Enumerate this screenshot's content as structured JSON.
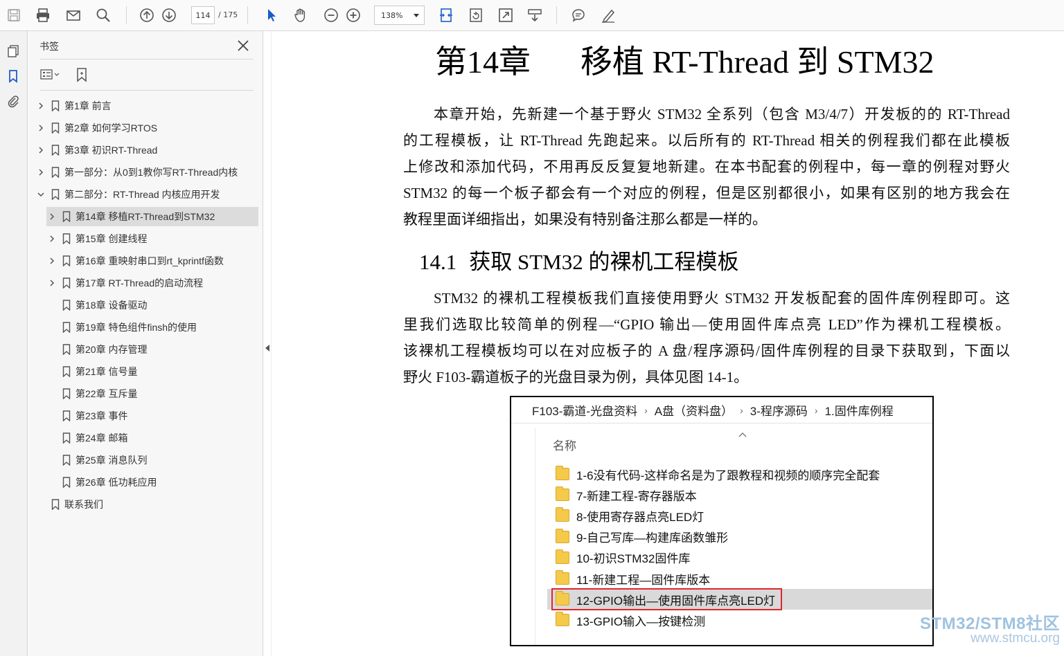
{
  "toolbar": {
    "page_current": "114",
    "page_total": "/ 175",
    "zoom": "138%",
    "icons": [
      "save-icon",
      "print-icon",
      "email-icon",
      "search-icon",
      "page-up-icon",
      "page-down-icon",
      "select-cursor-icon",
      "hand-tool-icon",
      "zoom-out-icon",
      "zoom-in-icon",
      "fit-page-icon",
      "rotate-icon",
      "full-screen-icon",
      "read-mode-icon",
      "comment-icon",
      "sign-icon"
    ]
  },
  "left_rail": {
    "icons": [
      "pages-thumbnail-icon",
      "bookmark-icon",
      "attachment-icon"
    ]
  },
  "bookmarks_panel": {
    "title": "书签",
    "items": [
      {
        "label": "第1章  前言",
        "level": 0,
        "expandable": true,
        "selected": false
      },
      {
        "label": "第2章  如何学习RTOS",
        "level": 0,
        "expandable": true,
        "selected": false
      },
      {
        "label": "第3章  初识RT-Thread",
        "level": 0,
        "expandable": true,
        "selected": false
      },
      {
        "label": "第一部分：从0到1教你写RT-Thread内核",
        "level": 0,
        "expandable": true,
        "selected": false
      },
      {
        "label": "第二部分：RT-Thread 内核应用开发",
        "level": 0,
        "expandable": true,
        "expanded": true,
        "selected": false
      },
      {
        "label": "第14章  移植RT-Thread到STM32",
        "level": 1,
        "expandable": true,
        "selected": true
      },
      {
        "label": "第15章  创建线程",
        "level": 1,
        "expandable": true,
        "selected": false
      },
      {
        "label": "第16章  重映射串口到rt_kprintf函数",
        "level": 1,
        "expandable": true,
        "selected": false
      },
      {
        "label": "第17章  RT-Thread的启动流程",
        "level": 1,
        "expandable": true,
        "selected": false
      },
      {
        "label": "第18章  设备驱动",
        "level": 1,
        "expandable": false,
        "selected": false
      },
      {
        "label": "第19章  特色组件finsh的使用",
        "level": 1,
        "expandable": false,
        "selected": false
      },
      {
        "label": "第20章  内存管理",
        "level": 1,
        "expandable": false,
        "selected": false
      },
      {
        "label": "第21章  信号量",
        "level": 1,
        "expandable": false,
        "selected": false
      },
      {
        "label": "第22章  互斥量",
        "level": 1,
        "expandable": false,
        "selected": false
      },
      {
        "label": "第23章  事件",
        "level": 1,
        "expandable": false,
        "selected": false
      },
      {
        "label": "第24章  邮箱",
        "level": 1,
        "expandable": false,
        "selected": false
      },
      {
        "label": "第25章  消息队列",
        "level": 1,
        "expandable": false,
        "selected": false
      },
      {
        "label": "第26章  低功耗应用",
        "level": 1,
        "expandable": false,
        "selected": false
      },
      {
        "label": "联系我们",
        "level": 0,
        "expandable": false,
        "selected": false
      }
    ]
  },
  "document": {
    "chapter_number": "第14章",
    "chapter_title": "移植 RT-Thread 到 STM32",
    "intro_lines": [
      "本章开始，先新建一个基于野火 STM32 全系列（包含 M3/4/7）开发板的的 RT-Thread",
      "的工程模板，让 RT-Thread 先跑起来。以后所有的 RT-Thread 相关的例程我们都在此模板",
      "上修改和添加代码，不用再反反复复地新建。在本书配套的例程中，每一章的例程对野火",
      "STM32 的每一个板子都会有一个对应的例程，但是区别都很小，如果有区别的地方我会在",
      "教程里面详细指出，如果没有特别备注那么都是一样的。"
    ],
    "section_number": "14.1",
    "section_title": "获取 STM32 的裸机工程模板",
    "section_lines": [
      "STM32 的裸机工程模板我们直接使用野火 STM32 开发板配套的固件库例程即可。这",
      "里我们选取比较简单的例程—“GPIO 输出—使用固件库点亮 LED”作为裸机工程模板。",
      "该裸机工程模板均可以在对应板子的 A 盘/程序源码/固件库例程的目录下获取到，下面以",
      "野火 F103-霸道板子的光盘目录为例，具体见图 14-1。"
    ],
    "figure": {
      "breadcrumbs": [
        "F103-霸道-光盘资料",
        "A盘（资料盘）",
        "3-程序源码",
        "1.固件库例程"
      ],
      "column_header": "名称",
      "folders": [
        "1-6没有代码-这样命名是为了跟教程和视频的顺序完全配套",
        "7-新建工程-寄存器版本",
        "8-使用寄存器点亮LED灯",
        "9-自己写库—构建库函数雏形",
        "10-初识STM32固件库",
        "11-新建工程—固件库版本",
        "12-GPIO输出—使用固件库点亮LED灯",
        "13-GPIO输入—按键检测"
      ],
      "highlighted_index": 6
    }
  },
  "watermark": {
    "line1": "STM32/STM8社区",
    "line2": "www.stmcu.org"
  },
  "colors": {
    "accent_blue": "#1c5cc9",
    "highlight_red": "#e0262b",
    "folder_yellow": "#f5c94a"
  }
}
